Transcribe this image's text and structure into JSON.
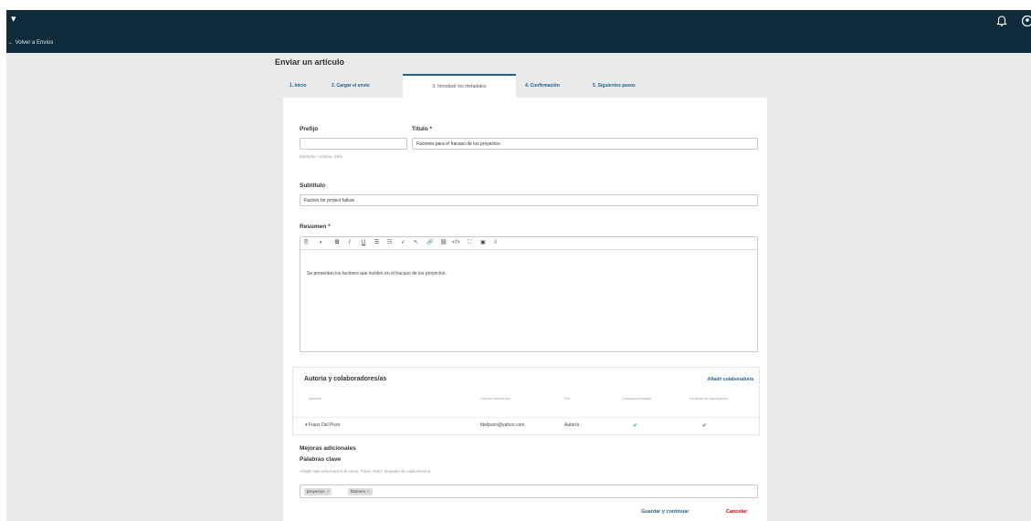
{
  "header": {
    "menu_glyph": "▾",
    "back_link": "← Volver a Envíos"
  },
  "page_title": "Enviar un artículo",
  "tabs": [
    {
      "label": "1. Inicio"
    },
    {
      "label": "2. Cargar el envío"
    },
    {
      "label": "3. Introducir los metadatos"
    },
    {
      "label": "4. Confirmación"
    },
    {
      "label": "5. Siguientes pasos"
    }
  ],
  "form": {
    "prefix_label": "Prefijo",
    "prefix_value": "",
    "prefix_help": "Ejemplos: Un/una, El/la",
    "title_label": "Título *",
    "title_value": "Factores para el fracaso de los proyectos",
    "subtitle_label": "Subtítulo",
    "subtitle_value": "Factors for project failure",
    "abstract_label": "Resumen *",
    "abstract_value": "Se presentan los factores que inciden en el fracaso de los proyectos."
  },
  "editor_toolbar": [
    "⎘",
    "◐",
    "B",
    "I",
    "U",
    "☰",
    "☷",
    "✓",
    "↖",
    "🔗",
    "⛓",
    "</>",
    "⛶",
    "▣",
    "⇩"
  ],
  "authors": {
    "title": "Autoría y colaboradores/as",
    "add_label": "Añadir colaborador/a",
    "headers": [
      "Nombre",
      "Correo electrónico",
      "Rol",
      "Contacto principal",
      "En listas de navegación"
    ],
    "rows": [
      {
        "name": "▾  Franz Del Pozo",
        "email": "fdelpozo@yahoo.com",
        "role": "Autor/a"
      }
    ],
    "check_glyph": "✔"
  },
  "extra": {
    "additional_title": "Mejoras adicionales",
    "keywords_label": "Palabras clave",
    "keywords_help": "Añadir más información al envío. Pulse \"Intro\" después de cada término.",
    "keywords": [
      "proyectos",
      "factores"
    ],
    "remove_glyph": "×"
  },
  "actions": {
    "save_label": "Guardar y continuar",
    "cancel_label": "Cancelar"
  },
  "colors": {
    "header_bg": "#0e2a3b",
    "link": "#1e6292",
    "check": "#00b28b",
    "cancel": "#d00000"
  }
}
